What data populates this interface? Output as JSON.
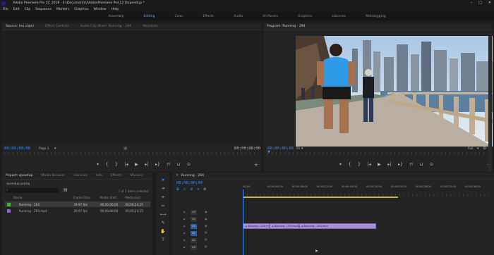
{
  "titlebar": {
    "title": "Adobe Premiere Pro CC 2018 - E:\\Documents\\Adobe\\Premiere Pro\\12.0\\speedup *",
    "min": "–",
    "max": "□",
    "close": "✕"
  },
  "menu": [
    "File",
    "Edit",
    "Clip",
    "Sequence",
    "Markers",
    "Graphics",
    "Window",
    "Help"
  ],
  "workspaces": [
    "Assembly",
    "Editing",
    "Color",
    "Effects",
    "Audio",
    "All Panels",
    "Graphics",
    "Libraries",
    "Metalogging"
  ],
  "workspace_active_index": 1,
  "source": {
    "tabs": [
      "Source: (no clips)",
      "Effect Controls",
      "Audio Clip Mixer: Running - 294",
      "Metadata"
    ],
    "timecode_left": "00;00;00;00",
    "fit": "Page 1",
    "timecode_right": "00;00;00;00"
  },
  "program": {
    "tab": "Program: Running - 294",
    "timecode_left": "00;00;00;00",
    "fit": "Fit",
    "zoom": "Full",
    "timecode_right": "00;00;00;00"
  },
  "project": {
    "tabs": [
      "Project: speedup",
      "Media Browser",
      "Libraries",
      "Info",
      "Effects",
      "Markers"
    ],
    "folder": "speedup.prproj",
    "selected_count": "1 of 2 items selected",
    "columns": [
      "Name",
      "Frame Rate",
      "Media Start",
      "Media End"
    ],
    "items": [
      {
        "name": "Running - 294",
        "fps": "29.97 fps",
        "start": "00;00;00;00",
        "end": "00;00;24;15",
        "color": "#3fb23f"
      },
      {
        "name": "Running - 294.mp4",
        "fps": "29.97 fps",
        "start": "00;00;00;00",
        "end": "00;00;24;15",
        "color": "#8d63c9"
      }
    ]
  },
  "timeline": {
    "tab": "Running - 294",
    "timecode": "00;00;00;00",
    "ruler_labels": [
      "00;00",
      "00;00;04;00",
      "00;00;08;00",
      "00;00;12;00",
      "00;00;16;00",
      "00;00;20;00",
      "00;00;24;00",
      "00;00;28;00",
      "00;00;32;00",
      "00;00;36;00"
    ],
    "tracks": [
      "V3",
      "V2",
      "V1",
      "A1",
      "A2",
      "A3"
    ],
    "clips": [
      {
        "label": "Running - 294.mp4",
        "start": 0,
        "end": 4.3
      },
      {
        "label": "Running - 294.mp4",
        "start": 4.3,
        "end": 9.1
      },
      {
        "label": "Running - 294.mp4",
        "start": 9.1,
        "end": 21.6
      }
    ],
    "seconds_per_label": 4
  }
}
